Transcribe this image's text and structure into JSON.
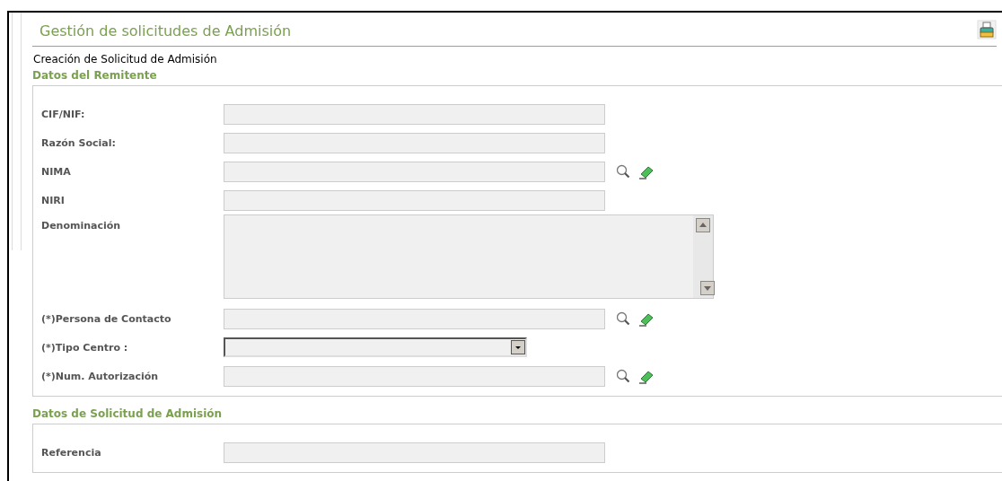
{
  "page": {
    "title": "Gestión de solicitudes de Admisión",
    "subtitle": "Creación de Solicitud de Admisión"
  },
  "sections": [
    {
      "title": "Datos del Remitente",
      "fields": [
        {
          "label": "CIF/NIF:",
          "kind": "text",
          "lookup": false
        },
        {
          "label": "Razón Social:",
          "kind": "text",
          "lookup": false
        },
        {
          "label": "NIMA",
          "kind": "text",
          "lookup": true
        },
        {
          "label": "NIRI",
          "kind": "text",
          "lookup": false
        },
        {
          "label": "Denominación",
          "kind": "textarea",
          "lookup": false
        },
        {
          "label": "(*)Persona de Contacto",
          "kind": "text",
          "lookup": true
        },
        {
          "label": "(*)Tipo Centro :",
          "kind": "select",
          "lookup": false
        },
        {
          "label": "(*)Num. Autorización",
          "kind": "text",
          "lookup": true
        }
      ]
    },
    {
      "title": "Datos de Solicitud de Admisión",
      "fields": [
        {
          "label": "Referencia",
          "kind": "text",
          "lookup": false
        }
      ]
    }
  ]
}
